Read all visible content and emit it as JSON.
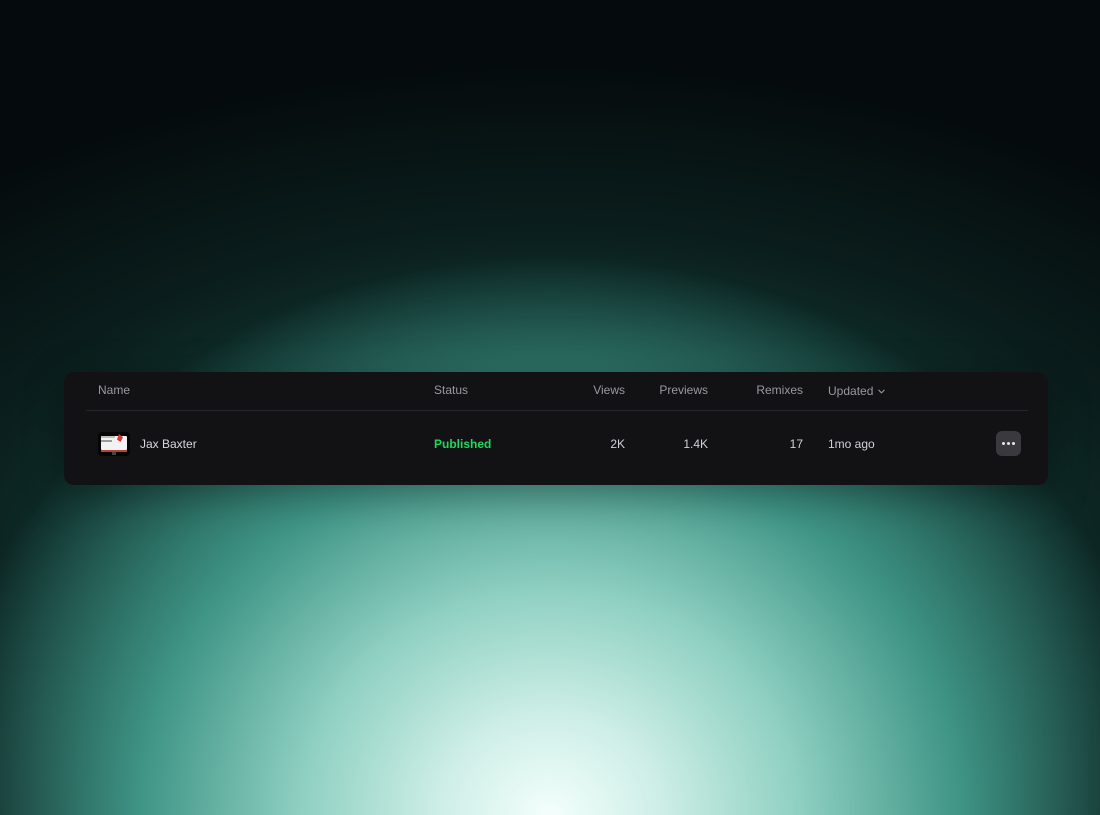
{
  "colors": {
    "panel_background": "#121114",
    "status_published": "#1ed760",
    "header_text": "#9a999f",
    "row_text": "#d2d1d6"
  },
  "table": {
    "columns": {
      "name": "Name",
      "status": "Status",
      "views": "Views",
      "previews": "Previews",
      "remixes": "Remixes",
      "updated": "Updated"
    },
    "sort_icon": "chevron-down-icon",
    "rows": [
      {
        "thumbnail": "project-thumbnail",
        "name": "Jax Baxter",
        "status": "Published",
        "views": "2K",
        "previews": "1.4K",
        "remixes": "17",
        "updated": "1mo ago",
        "more_icon": "more-horizontal-icon"
      }
    ]
  }
}
